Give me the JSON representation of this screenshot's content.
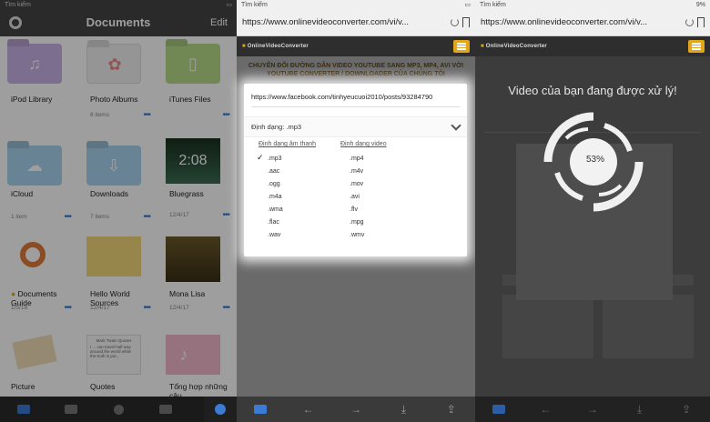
{
  "panel_documents": {
    "status": {
      "carrier": "Tìm kiếm",
      "right": ""
    },
    "nav": {
      "title": "Documents",
      "edit_label": "Edit"
    },
    "items": [
      {
        "name": "iPod Library",
        "meta": ""
      },
      {
        "name": "Photo Albums",
        "meta": "8 items"
      },
      {
        "name": "iTunes Files",
        "meta": ""
      },
      {
        "name": "iCloud",
        "meta": "1 item"
      },
      {
        "name": "Downloads",
        "meta": "7 items"
      },
      {
        "name": "Bluegrass",
        "meta": "12/4/17",
        "duration": "2:08"
      },
      {
        "name": "Documents Guide",
        "meta": "1/5/18"
      },
      {
        "name": "Hello World Sources",
        "meta": "12/4/17"
      },
      {
        "name": "Mona Lisa",
        "meta": "12/4/17"
      },
      {
        "name": "Picture",
        "meta": ""
      },
      {
        "name": "Quotes",
        "meta": "",
        "thumb_title": "Mark Twain Quotes",
        "thumb_text": "I ... can travel half way around the world while the truth is put..."
      },
      {
        "name": "Tổng hợp những câu",
        "meta": ""
      }
    ]
  },
  "panel_converter": {
    "status": {
      "carrier": "Tìm kiếm"
    },
    "url": "https://www.onlinevideoconverter.com/vi/v...",
    "site_logo": "OnlineVideoConverter",
    "headline": "CHUYỂN ĐỔI ĐƯỜNG DẪN VIDEO YOUTUBE SANG MP3, MP4, AVI VỚI YOUTUBE CONVERTER / DOWNLOADER CỦA CHÚNG TÔI",
    "input_url": "https://www.facebook.com/tinhyeucuoi2010/posts/93284790",
    "format_label": "Định dạng: .mp3",
    "audio_header": "Định dạng âm thanh",
    "video_header": "Định dạng video",
    "audio_formats": [
      ".mp3",
      ".aac",
      ".ogg",
      ".m4a",
      ".wma",
      ".flac",
      ".wav"
    ],
    "video_formats": [
      ".mp4",
      ".m4v",
      ".mov",
      ".avi",
      ".flv",
      ".mpg",
      ".wmv"
    ],
    "selected_format": ".mp3"
  },
  "panel_processing": {
    "status": {
      "carrier": "Tìm kiếm",
      "battery": "9%"
    },
    "url": "https://www.onlinevideoconverter.com/vi/v...",
    "site_logo": "OnlineVideoConverter",
    "message": "Video của bạn đang được xử lý!",
    "progress_label": "53%",
    "progress": 0.53
  },
  "colors": {
    "accent": "#3a7bd5",
    "brand": "#e5a51b"
  }
}
